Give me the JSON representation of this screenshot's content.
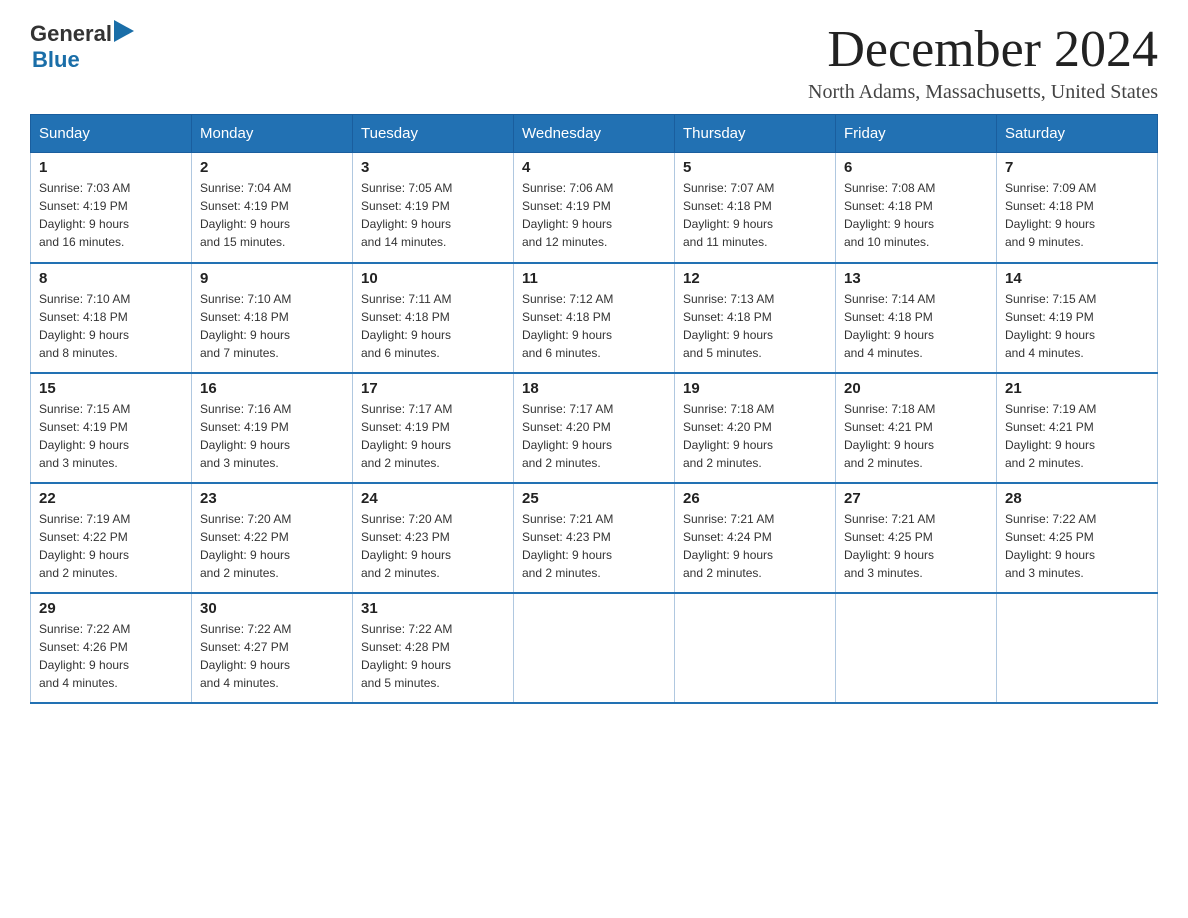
{
  "logo": {
    "general": "General",
    "blue": "Blue"
  },
  "title": {
    "month": "December 2024",
    "location": "North Adams, Massachusetts, United States"
  },
  "header_days": [
    "Sunday",
    "Monday",
    "Tuesday",
    "Wednesday",
    "Thursday",
    "Friday",
    "Saturday"
  ],
  "weeks": [
    [
      {
        "day": "1",
        "sunrise": "7:03 AM",
        "sunset": "4:19 PM",
        "daylight": "9 hours and 16 minutes."
      },
      {
        "day": "2",
        "sunrise": "7:04 AM",
        "sunset": "4:19 PM",
        "daylight": "9 hours and 15 minutes."
      },
      {
        "day": "3",
        "sunrise": "7:05 AM",
        "sunset": "4:19 PM",
        "daylight": "9 hours and 14 minutes."
      },
      {
        "day": "4",
        "sunrise": "7:06 AM",
        "sunset": "4:19 PM",
        "daylight": "9 hours and 12 minutes."
      },
      {
        "day": "5",
        "sunrise": "7:07 AM",
        "sunset": "4:18 PM",
        "daylight": "9 hours and 11 minutes."
      },
      {
        "day": "6",
        "sunrise": "7:08 AM",
        "sunset": "4:18 PM",
        "daylight": "9 hours and 10 minutes."
      },
      {
        "day": "7",
        "sunrise": "7:09 AM",
        "sunset": "4:18 PM",
        "daylight": "9 hours and 9 minutes."
      }
    ],
    [
      {
        "day": "8",
        "sunrise": "7:10 AM",
        "sunset": "4:18 PM",
        "daylight": "9 hours and 8 minutes."
      },
      {
        "day": "9",
        "sunrise": "7:10 AM",
        "sunset": "4:18 PM",
        "daylight": "9 hours and 7 minutes."
      },
      {
        "day": "10",
        "sunrise": "7:11 AM",
        "sunset": "4:18 PM",
        "daylight": "9 hours and 6 minutes."
      },
      {
        "day": "11",
        "sunrise": "7:12 AM",
        "sunset": "4:18 PM",
        "daylight": "9 hours and 6 minutes."
      },
      {
        "day": "12",
        "sunrise": "7:13 AM",
        "sunset": "4:18 PM",
        "daylight": "9 hours and 5 minutes."
      },
      {
        "day": "13",
        "sunrise": "7:14 AM",
        "sunset": "4:18 PM",
        "daylight": "9 hours and 4 minutes."
      },
      {
        "day": "14",
        "sunrise": "7:15 AM",
        "sunset": "4:19 PM",
        "daylight": "9 hours and 4 minutes."
      }
    ],
    [
      {
        "day": "15",
        "sunrise": "7:15 AM",
        "sunset": "4:19 PM",
        "daylight": "9 hours and 3 minutes."
      },
      {
        "day": "16",
        "sunrise": "7:16 AM",
        "sunset": "4:19 PM",
        "daylight": "9 hours and 3 minutes."
      },
      {
        "day": "17",
        "sunrise": "7:17 AM",
        "sunset": "4:19 PM",
        "daylight": "9 hours and 2 minutes."
      },
      {
        "day": "18",
        "sunrise": "7:17 AM",
        "sunset": "4:20 PM",
        "daylight": "9 hours and 2 minutes."
      },
      {
        "day": "19",
        "sunrise": "7:18 AM",
        "sunset": "4:20 PM",
        "daylight": "9 hours and 2 minutes."
      },
      {
        "day": "20",
        "sunrise": "7:18 AM",
        "sunset": "4:21 PM",
        "daylight": "9 hours and 2 minutes."
      },
      {
        "day": "21",
        "sunrise": "7:19 AM",
        "sunset": "4:21 PM",
        "daylight": "9 hours and 2 minutes."
      }
    ],
    [
      {
        "day": "22",
        "sunrise": "7:19 AM",
        "sunset": "4:22 PM",
        "daylight": "9 hours and 2 minutes."
      },
      {
        "day": "23",
        "sunrise": "7:20 AM",
        "sunset": "4:22 PM",
        "daylight": "9 hours and 2 minutes."
      },
      {
        "day": "24",
        "sunrise": "7:20 AM",
        "sunset": "4:23 PM",
        "daylight": "9 hours and 2 minutes."
      },
      {
        "day": "25",
        "sunrise": "7:21 AM",
        "sunset": "4:23 PM",
        "daylight": "9 hours and 2 minutes."
      },
      {
        "day": "26",
        "sunrise": "7:21 AM",
        "sunset": "4:24 PM",
        "daylight": "9 hours and 2 minutes."
      },
      {
        "day": "27",
        "sunrise": "7:21 AM",
        "sunset": "4:25 PM",
        "daylight": "9 hours and 3 minutes."
      },
      {
        "day": "28",
        "sunrise": "7:22 AM",
        "sunset": "4:25 PM",
        "daylight": "9 hours and 3 minutes."
      }
    ],
    [
      {
        "day": "29",
        "sunrise": "7:22 AM",
        "sunset": "4:26 PM",
        "daylight": "9 hours and 4 minutes."
      },
      {
        "day": "30",
        "sunrise": "7:22 AM",
        "sunset": "4:27 PM",
        "daylight": "9 hours and 4 minutes."
      },
      {
        "day": "31",
        "sunrise": "7:22 AM",
        "sunset": "4:28 PM",
        "daylight": "9 hours and 5 minutes."
      },
      null,
      null,
      null,
      null
    ]
  ],
  "labels": {
    "sunrise": "Sunrise:",
    "sunset": "Sunset:",
    "daylight": "Daylight:"
  }
}
